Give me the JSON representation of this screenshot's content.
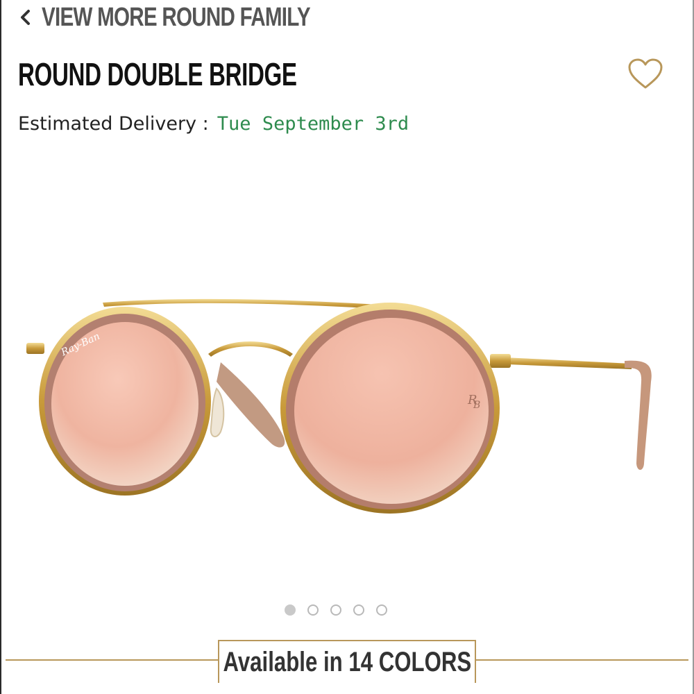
{
  "nav": {
    "back_label": "VIEW MORE ROUND FAMILY",
    "back_icon": "chevron-left-icon"
  },
  "product": {
    "title": "ROUND DOUBLE BRIDGE",
    "wishlist_icon": "heart-outline-icon",
    "delivery_label": "Estimated Delivery :",
    "delivery_date": "Tue September 3rd",
    "image_alt": "Round double bridge sunglasses with gold frame and pink gradient lenses",
    "lens_logo_left": "Ray-Ban",
    "lens_logo_right": "RB"
  },
  "carousel": {
    "total": 5,
    "active_index": 0
  },
  "colors": {
    "label": "Available in 14 COLORS"
  },
  "theme": {
    "accent_gold": "#b8975a",
    "delivery_green": "#2e8b4e",
    "heading_dark": "#111111",
    "nav_gray": "#555555"
  }
}
